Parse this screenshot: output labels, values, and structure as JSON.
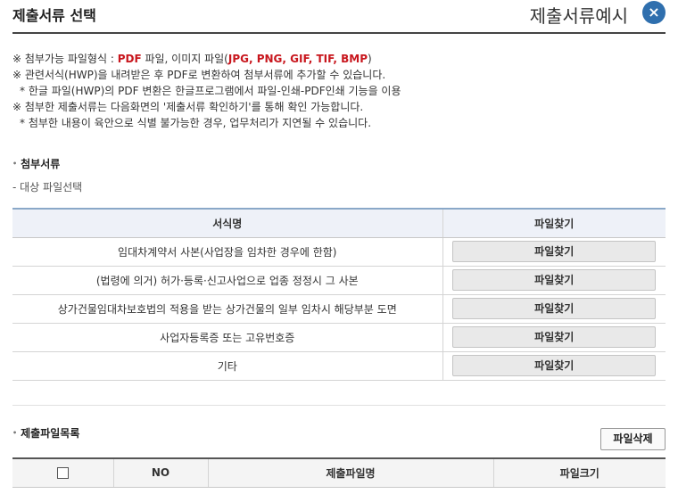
{
  "header": {
    "title": "제출서류 선택",
    "sample_label": "제출서류예시",
    "close_glyph": "×"
  },
  "notes": {
    "line1_prefix": "※ 첨부가능 파일형식 : ",
    "line1_pdf": "PDF",
    "line1_mid": " 파일, 이미지 파일(",
    "line1_img": "JPG, PNG, GIF, TIF, BMP",
    "line1_suffix": ")",
    "line2": "※ 관련서식(HWP)을 내려받은 후 PDF로 변환하여 첨부서류에 추가할 수 있습니다.",
    "line3": "* 한글 파일(HWP)의 PDF 변환은 한글프로그램에서 파일-인쇄-PDF인쇄 기능을 이용",
    "line4": "※ 첨부한 제출서류는 다음화면의 '제출서류 확인하기'를 통해 확인 가능합니다.",
    "line5": "* 첨부한 내용이 육안으로 식별 불가능한 경우, 업무처리가 지연될 수 있습니다."
  },
  "attach": {
    "section_title": "첨부서류",
    "desc": "- 대상 파일선택",
    "col_form": "서식명",
    "col_find": "파일찾기",
    "button_label": "파일찾기",
    "rows": [
      "임대차계약서 사본(사업장을 임차한 경우에 한함)",
      "(법령에 의거) 허가·등록·신고사업으로 업종 정정시 그 사본",
      "상가건물임대차보호법의 적용을 받는 상가건물의 일부 임차시 해당부분 도면",
      "사업자등록증 또는 고유번호증",
      "기타"
    ]
  },
  "files": {
    "section_title": "제출파일목록",
    "delete_button": "파일삭제",
    "col_no": "NO",
    "col_name": "제출파일명",
    "col_size": "파일크기"
  }
}
